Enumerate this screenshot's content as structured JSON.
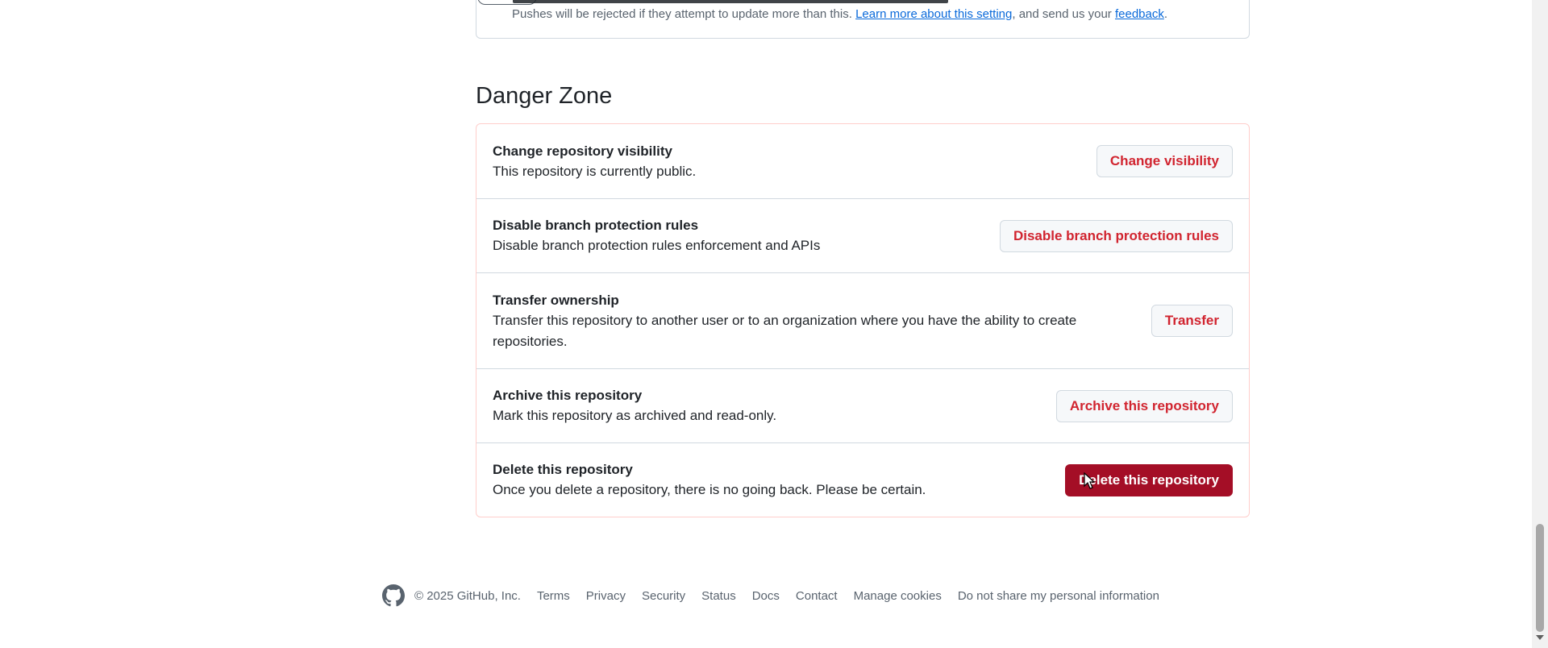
{
  "top_section": {
    "note_prefix": "Pushes will be rejected if they attempt to update more than this. ",
    "learn_more_link": "Learn more about this setting",
    "note_middle": ", and send us your ",
    "feedback_link": "feedback",
    "note_suffix": "."
  },
  "danger_zone": {
    "title": "Danger Zone",
    "rows": [
      {
        "title": "Change repository visibility",
        "desc": "This repository is currently public.",
        "button": "Change visibility"
      },
      {
        "title": "Disable branch protection rules",
        "desc": "Disable branch protection rules enforcement and APIs",
        "button": "Disable branch protection rules"
      },
      {
        "title": "Transfer ownership",
        "desc": "Transfer this repository to another user or to an organization where you have the ability to create repositories.",
        "button": "Transfer"
      },
      {
        "title": "Archive this repository",
        "desc": "Mark this repository as archived and read-only.",
        "button": "Archive this repository"
      },
      {
        "title": "Delete this repository",
        "desc": "Once you delete a repository, there is no going back. Please be certain.",
        "button": "Delete this repository"
      }
    ]
  },
  "footer": {
    "logo_icon": "github-icon",
    "copyright": "© 2025 GitHub, Inc.",
    "links": [
      "Terms",
      "Privacy",
      "Security",
      "Status",
      "Docs",
      "Contact",
      "Manage cookies",
      "Do not share my personal information"
    ]
  },
  "colors": {
    "danger_text": "#d1242f",
    "danger_button_bg": "#a40e26",
    "danger_border": "#ffcecb",
    "link": "#0969da"
  }
}
